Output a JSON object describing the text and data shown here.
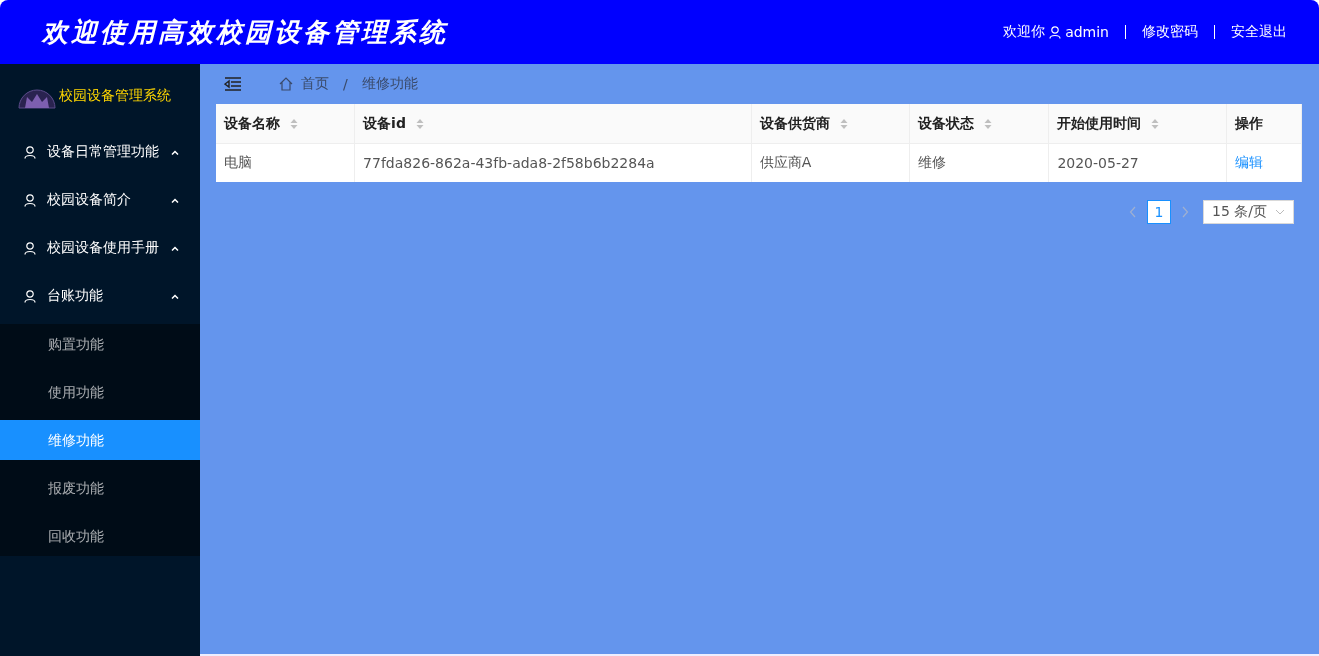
{
  "header": {
    "title": "欢迎使用高效校园设备管理系统",
    "welcome": "欢迎你",
    "user": "admin",
    "links": [
      "修改密码",
      "安全退出"
    ]
  },
  "sidebar": {
    "logo_text": "校园设备管理系统",
    "items": [
      {
        "label": "设备日常管理功能"
      },
      {
        "label": "校园设备简介"
      },
      {
        "label": "校园设备使用手册"
      },
      {
        "label": "台账功能",
        "children": [
          {
            "label": "购置功能",
            "selected": false
          },
          {
            "label": "使用功能",
            "selected": false
          },
          {
            "label": "维修功能",
            "selected": true
          },
          {
            "label": "报废功能",
            "selected": false
          },
          {
            "label": "回收功能",
            "selected": false
          }
        ]
      }
    ]
  },
  "breadcrumb": {
    "separator": "/",
    "items": [
      "首页",
      "维修功能"
    ]
  },
  "table": {
    "columns": [
      {
        "label": "设备名称",
        "sortable": true
      },
      {
        "label": "设备id",
        "sortable": true
      },
      {
        "label": "设备供货商",
        "sortable": true
      },
      {
        "label": "设备状态",
        "sortable": true
      },
      {
        "label": "开始使用时间",
        "sortable": true
      },
      {
        "label": "操作",
        "sortable": false
      }
    ],
    "rows": [
      {
        "cells": [
          "电脑",
          "77fda826-862a-43fb-ada8-2f58b6b2284a",
          "供应商A",
          "维修",
          "2020-05-27"
        ],
        "action": "编辑"
      }
    ]
  },
  "pagination": {
    "pages": [
      {
        "label": "1",
        "selected": true
      }
    ],
    "page_size": "15 条/页"
  }
}
